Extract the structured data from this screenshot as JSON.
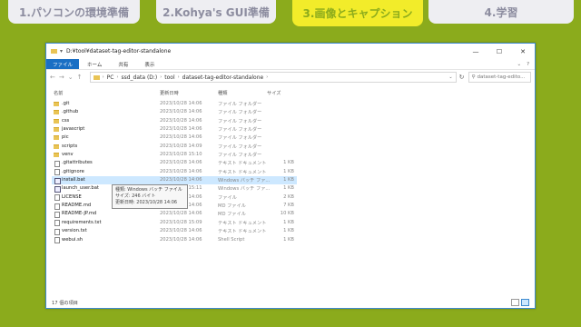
{
  "tabs": [
    {
      "label": "1.パソコンの環境準備",
      "active": false
    },
    {
      "label": "2.Kohya's GUI準備",
      "active": false
    },
    {
      "label": "3.画像とキャプション",
      "active": true
    },
    {
      "label": "4.学習",
      "active": false
    }
  ],
  "window": {
    "title": "D:¥tool¥dataset-tag-editor-standalone",
    "controls": {
      "minimize": "—",
      "maximize": "☐",
      "close": "✕"
    }
  },
  "ribbon": {
    "file": "ファイル",
    "home": "ホーム",
    "share": "共有",
    "view": "表示"
  },
  "address": {
    "crumbs": [
      "PC",
      "ssd_data (D:)",
      "tool",
      "dataset-tag-editor-standalone"
    ],
    "search_placeholder": "dataset-tag-edito..."
  },
  "columns": {
    "name": "名前",
    "date": "更新日時",
    "type": "種類",
    "size": "サイズ"
  },
  "files": [
    {
      "name": ".git",
      "date": "2023/10/28 14:06",
      "type": "ファイル フォルダー",
      "size": "",
      "kind": "folder"
    },
    {
      "name": ".github",
      "date": "2023/10/28 14:06",
      "type": "ファイル フォルダー",
      "size": "",
      "kind": "folder"
    },
    {
      "name": "css",
      "date": "2023/10/28 14:06",
      "type": "ファイル フォルダー",
      "size": "",
      "kind": "folder"
    },
    {
      "name": "javascript",
      "date": "2023/10/28 14:06",
      "type": "ファイル フォルダー",
      "size": "",
      "kind": "folder"
    },
    {
      "name": "pic",
      "date": "2023/10/28 14:06",
      "type": "ファイル フォルダー",
      "size": "",
      "kind": "folder"
    },
    {
      "name": "scripts",
      "date": "2023/10/28 14:09",
      "type": "ファイル フォルダー",
      "size": "",
      "kind": "folder"
    },
    {
      "name": "venv",
      "date": "2023/10/28 15:10",
      "type": "ファイル フォルダー",
      "size": "",
      "kind": "folder"
    },
    {
      "name": ".gitattributes",
      "date": "2023/10/28 14:06",
      "type": "テキスト ドキュメント",
      "size": "1 KB",
      "kind": "file"
    },
    {
      "name": ".gitignore",
      "date": "2023/10/28 14:06",
      "type": "テキスト ドキュメント",
      "size": "1 KB",
      "kind": "file"
    },
    {
      "name": "install.bat",
      "date": "2023/10/28 14:06",
      "type": "Windows バッチ ファ...",
      "size": "1 KB",
      "kind": "bat",
      "selected": true
    },
    {
      "name": "launch_user.bat",
      "date": "2023/10/28 15:11",
      "type": "Windows バッチ ファ...",
      "size": "1 KB",
      "kind": "bat"
    },
    {
      "name": "LICENSE",
      "date": "2023/10/28 14:06",
      "type": "ファイル",
      "size": "2 KB",
      "kind": "file"
    },
    {
      "name": "README.md",
      "date": "2023/10/28 14:06",
      "type": "MD ファイル",
      "size": "7 KB",
      "kind": "file"
    },
    {
      "name": "README-JP.md",
      "date": "2023/10/28 14:06",
      "type": "MD ファイル",
      "size": "10 KB",
      "kind": "file"
    },
    {
      "name": "requirements.txt",
      "date": "2023/10/28 15:09",
      "type": "テキスト ドキュメント",
      "size": "1 KB",
      "kind": "file"
    },
    {
      "name": "version.txt",
      "date": "2023/10/28 14:06",
      "type": "テキスト ドキュメント",
      "size": "1 KB",
      "kind": "file"
    },
    {
      "name": "webui.sh",
      "date": "2023/10/28 14:06",
      "type": "Shell Script",
      "size": "1 KB",
      "kind": "file"
    }
  ],
  "tooltip": {
    "line1": "種類: Windows バッチ ファイル",
    "line2": "サイズ: 246 バイト",
    "line3": "更新日時: 2023/10/28 14:06"
  },
  "status": "17 個の項目"
}
